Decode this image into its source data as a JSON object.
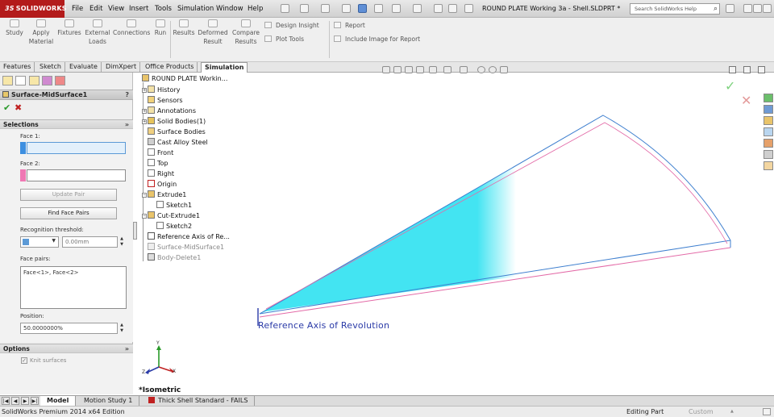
{
  "app": {
    "logo": "SOLIDWORKS",
    "document_title": "ROUND PLATE Working 3a - Shell.SLDPRT *",
    "search_placeholder": "Search SolidWorks Help",
    "menu": [
      "File",
      "Edit",
      "View",
      "Insert",
      "Tools",
      "Simulation",
      "Window",
      "Help"
    ]
  },
  "ribbon": {
    "study": "Study",
    "apply_material": [
      "Apply",
      "Material"
    ],
    "fixtures": "Fixtures",
    "external_loads": [
      "External",
      "Loads"
    ],
    "connections": "Connections",
    "run": "Run",
    "results": "Results",
    "deformed_result": [
      "Deformed",
      "Result"
    ],
    "compare_results": [
      "Compare",
      "Results"
    ],
    "design_insight": "Design Insight",
    "plot_tools": "Plot Tools",
    "report": "Report",
    "include_image": "Include Image for Report"
  },
  "tabs": [
    "Features",
    "Sketch",
    "Evaluate",
    "DimXpert",
    "Office Products",
    "Simulation"
  ],
  "active_tab": "Simulation",
  "property_manager": {
    "title": "Surface-MidSurface1",
    "help": "?",
    "selections": {
      "heading": "Selections",
      "face1_label": "Face 1:",
      "face2_label": "Face 2:",
      "update_pair": "Update Pair",
      "find_face_pairs": "Find Face Pairs",
      "threshold_label": "Recognition threshold:",
      "threshold_value": "0.00mm",
      "face_pairs_label": "Face pairs:",
      "face_pairs_value": "Face<1>, Face<2>",
      "position_label": "Position:",
      "position_value": "50.0000000%"
    },
    "options": {
      "heading": "Options",
      "knit_surfaces": "Knit surfaces"
    }
  },
  "feature_tree": {
    "root": "ROUND PLATE Workin...",
    "items": [
      "History",
      "Sensors",
      "Annotations",
      "Solid Bodies(1)",
      "Surface Bodies",
      "Cast Alloy Steel",
      "Front",
      "Top",
      "Right",
      "Origin",
      "Extrude1",
      "Sketch1",
      "Cut-Extrude1",
      "Sketch2",
      "Reference Axis of Re...",
      "Surface-MidSurface1",
      "Body-Delete1"
    ]
  },
  "viewport": {
    "axis_label": "Reference Axis of Revolution",
    "view_name": "*Isometric",
    "triad": [
      "Y",
      "X",
      "Z"
    ]
  },
  "bottom_tabs": [
    "Model",
    "Motion Study 1",
    "Thick Shell Standard - FAILS"
  ],
  "status": {
    "left": "SolidWorks Premium 2014 x64 Edition",
    "mode": "Editing Part",
    "units": "Custom"
  },
  "colors": {
    "brand": "#b31b1b",
    "face1": "#3d8fe0",
    "face2": "#ef78b4",
    "surface_fill": "#43e4f2",
    "edge_blue": "#3e7fcf",
    "edge_pink": "#e36aa7"
  }
}
